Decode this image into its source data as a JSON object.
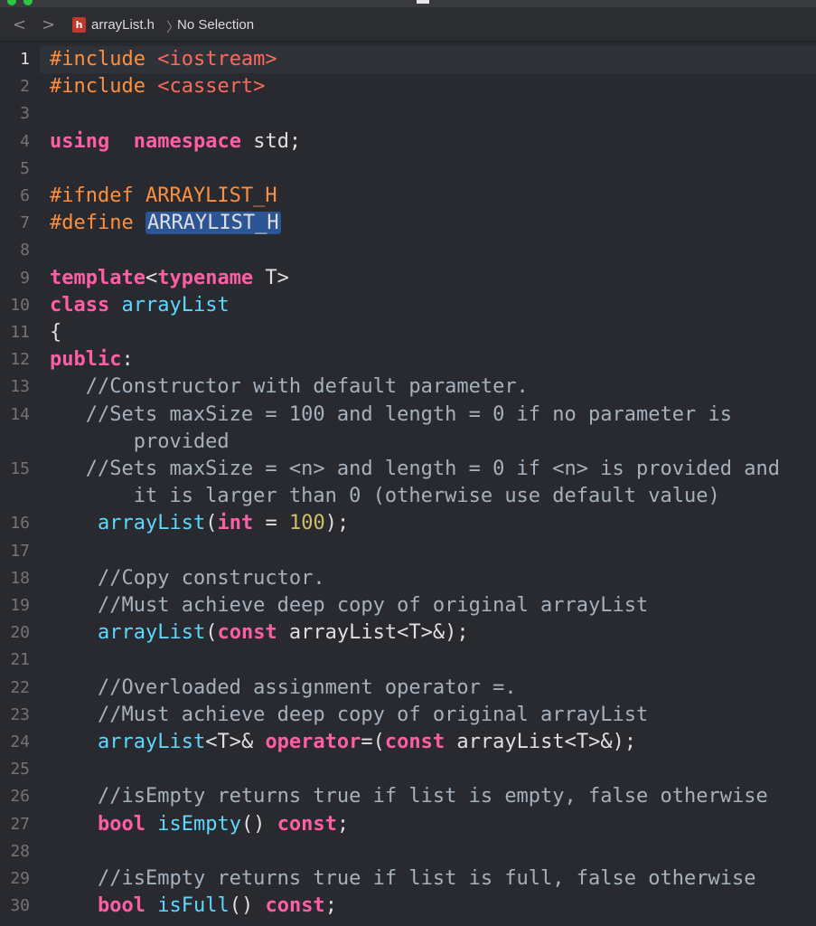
{
  "window": {
    "top_mark": "▬"
  },
  "jumpbar": {
    "back_icon": "chevron-left",
    "forward_icon": "chevron-right",
    "file_icon_letter": "h",
    "file_name": "arrayList.h",
    "separator": "〉",
    "selection": "No Selection"
  },
  "colors": {
    "background": "#292a30",
    "keyword": "#fc5fa3",
    "preprocessor": "#fd8f3f",
    "comment": "#a5b1bd",
    "type": "#5dd8ff",
    "selection": "#2c5596"
  },
  "editor": {
    "current_line": 1,
    "lines": [
      {
        "num": "1",
        "tokens": [
          [
            "pp",
            "#include "
          ],
          [
            "str",
            "<iostream>"
          ]
        ]
      },
      {
        "num": "2",
        "tokens": [
          [
            "pp",
            "#include "
          ],
          [
            "str",
            "<cassert>"
          ]
        ]
      },
      {
        "num": "3",
        "tokens": []
      },
      {
        "num": "4",
        "tokens": [
          [
            "kw",
            "using"
          ],
          [
            "",
            "  "
          ],
          [
            "kw",
            "namespace"
          ],
          [
            "",
            " std;"
          ]
        ]
      },
      {
        "num": "5",
        "tokens": []
      },
      {
        "num": "6",
        "tokens": [
          [
            "pp",
            "#ifndef ARRAYLIST_H"
          ]
        ]
      },
      {
        "num": "7",
        "tokens": [
          [
            "pp",
            "#define "
          ],
          [
            "sel",
            "ARRAYLIST_H"
          ]
        ]
      },
      {
        "num": "8",
        "tokens": []
      },
      {
        "num": "9",
        "tokens": [
          [
            "kw",
            "template"
          ],
          [
            "",
            "<"
          ],
          [
            "kw",
            "typename"
          ],
          [
            "",
            " T>"
          ]
        ]
      },
      {
        "num": "10",
        "tokens": [
          [
            "kw",
            "class"
          ],
          [
            "",
            " "
          ],
          [
            "ty",
            "arrayList"
          ]
        ]
      },
      {
        "num": "11",
        "tokens": [
          [
            "",
            "{"
          ]
        ]
      },
      {
        "num": "12",
        "tokens": [
          [
            "kw",
            "public"
          ],
          [
            "",
            ":"
          ]
        ]
      },
      {
        "num": "13",
        "tokens": [
          [
            "cm",
            "   //Constructor with default parameter."
          ]
        ]
      },
      {
        "num": "14",
        "tokens": [
          [
            "cm",
            "   //Sets maxSize = 100 and length = 0 if no parameter is"
          ]
        ]
      },
      {
        "num": "",
        "tokens": [
          [
            "cm",
            "       provided"
          ]
        ]
      },
      {
        "num": "15",
        "tokens": [
          [
            "cm",
            "   //Sets maxSize = <n> and length = 0 if <n> is provided and"
          ]
        ]
      },
      {
        "num": "",
        "tokens": [
          [
            "cm",
            "       it is larger than 0 (otherwise use default value)"
          ]
        ]
      },
      {
        "num": "16",
        "tokens": [
          [
            "",
            "    "
          ],
          [
            "ty",
            "arrayList"
          ],
          [
            "",
            "("
          ],
          [
            "kw",
            "int"
          ],
          [
            "",
            " = "
          ],
          [
            "num",
            "100"
          ],
          [
            "",
            ");"
          ]
        ]
      },
      {
        "num": "17",
        "tokens": []
      },
      {
        "num": "18",
        "tokens": [
          [
            "cm",
            "    //Copy constructor."
          ]
        ]
      },
      {
        "num": "19",
        "tokens": [
          [
            "cm",
            "    //Must achieve deep copy of original arrayList"
          ]
        ]
      },
      {
        "num": "20",
        "tokens": [
          [
            "",
            "    "
          ],
          [
            "ty",
            "arrayList"
          ],
          [
            "",
            "("
          ],
          [
            "kw",
            "const"
          ],
          [
            "",
            " arrayList<T>&);"
          ]
        ]
      },
      {
        "num": "21",
        "tokens": []
      },
      {
        "num": "22",
        "tokens": [
          [
            "cm",
            "    //Overloaded assignment operator =."
          ]
        ]
      },
      {
        "num": "23",
        "tokens": [
          [
            "cm",
            "    //Must achieve deep copy of original arrayList"
          ]
        ]
      },
      {
        "num": "24",
        "tokens": [
          [
            "",
            "    "
          ],
          [
            "ty",
            "arrayList"
          ],
          [
            "",
            "<T>& "
          ],
          [
            "kw",
            "operator"
          ],
          [
            "",
            "=("
          ],
          [
            "kw",
            "const"
          ],
          [
            "",
            " arrayList<T>&);"
          ]
        ]
      },
      {
        "num": "25",
        "tokens": []
      },
      {
        "num": "26",
        "tokens": [
          [
            "cm",
            "    //isEmpty returns true if list is empty, false otherwise"
          ]
        ]
      },
      {
        "num": "27",
        "tokens": [
          [
            "",
            "    "
          ],
          [
            "kw",
            "bool"
          ],
          [
            "",
            " "
          ],
          [
            "ty",
            "isEmpty"
          ],
          [
            "",
            "() "
          ],
          [
            "kw",
            "const"
          ],
          [
            "",
            ";"
          ]
        ]
      },
      {
        "num": "28",
        "tokens": []
      },
      {
        "num": "29",
        "tokens": [
          [
            "cm",
            "    //isEmpty returns true if list is full, false otherwise"
          ]
        ]
      },
      {
        "num": "30",
        "tokens": [
          [
            "",
            "    "
          ],
          [
            "kw",
            "bool"
          ],
          [
            "",
            " "
          ],
          [
            "ty",
            "isFull"
          ],
          [
            "",
            "() "
          ],
          [
            "kw",
            "const"
          ],
          [
            "",
            ";"
          ]
        ]
      }
    ]
  }
}
